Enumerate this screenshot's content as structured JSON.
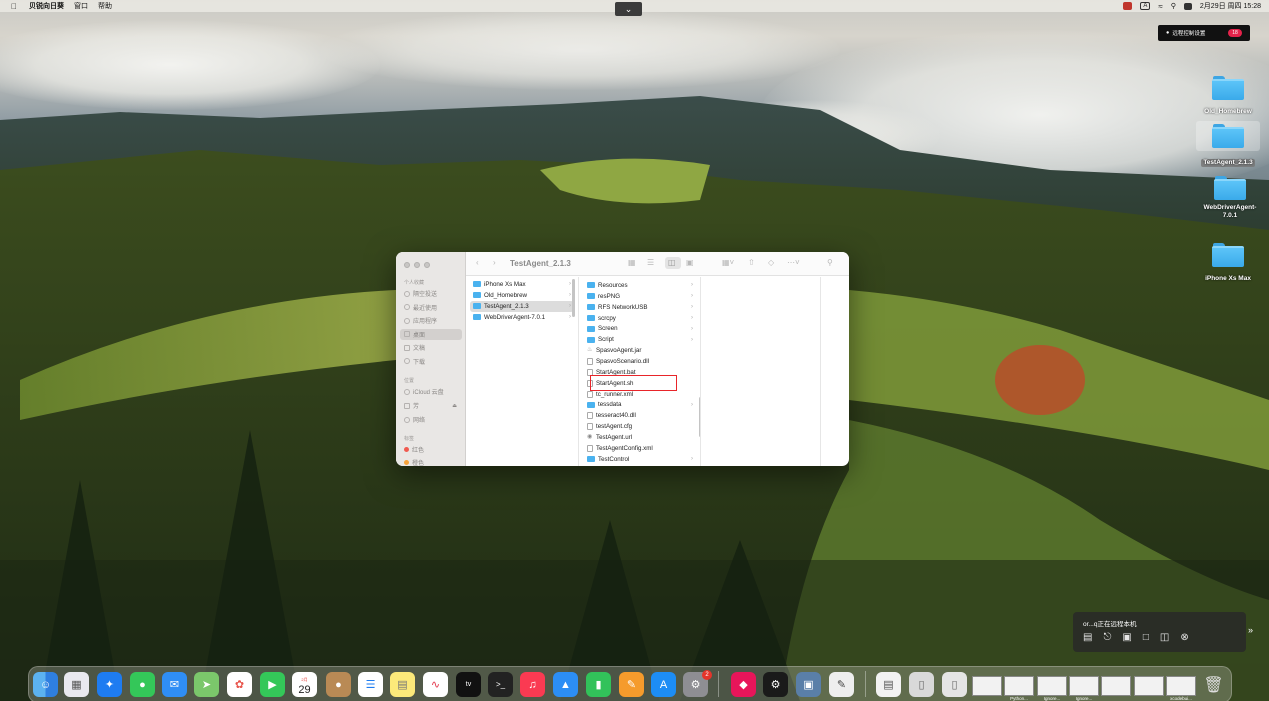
{
  "menubar": {
    "app_name": "贝锐向日葵",
    "items": [
      "窗口",
      "帮助"
    ],
    "status": {
      "input_mode": "A",
      "datetime": "2月29日 周四 15:28"
    }
  },
  "remote_control": {
    "button_label": "远程控制设置",
    "record_badge": "18"
  },
  "desktop_icons": [
    {
      "label": "Old_Homebrew"
    },
    {
      "label": "TestAgent_2.1.3"
    },
    {
      "label": "WebDriverAgent-7.0.1"
    },
    {
      "label": "iPhone Xs Max"
    }
  ],
  "finder": {
    "title": "TestAgent_2.1.3",
    "sidebar": {
      "favorites_heading": "个人收藏",
      "favorites": [
        "隔空投送",
        "最近使用",
        "应用程序",
        "桌面",
        "文稿",
        "下载"
      ],
      "locations_heading": "位置",
      "locations": [
        "iCloud 云盘",
        "芳",
        "网络"
      ],
      "tags_heading": "标签",
      "tags": [
        "红色",
        "橙色"
      ]
    },
    "column1": [
      "iPhone Xs Max",
      "Old_Homebrew",
      "TestAgent_2.1.3",
      "WebDriverAgent-7.0.1"
    ],
    "column2": [
      {
        "name": "Resources",
        "kind": "folder"
      },
      {
        "name": "resPNG",
        "kind": "folder"
      },
      {
        "name": "RFS NetworkUSB",
        "kind": "folder"
      },
      {
        "name": "scrcpy",
        "kind": "folder"
      },
      {
        "name": "Screen",
        "kind": "folder"
      },
      {
        "name": "Script",
        "kind": "folder"
      },
      {
        "name": "SpasvoAgent.jar",
        "kind": "jar"
      },
      {
        "name": "SpasvoScenario.dll",
        "kind": "file"
      },
      {
        "name": "StartAgent.bat",
        "kind": "file"
      },
      {
        "name": "StartAgent.sh",
        "kind": "file"
      },
      {
        "name": "tc_runner.xml",
        "kind": "file"
      },
      {
        "name": "tessdata",
        "kind": "folder"
      },
      {
        "name": "tesseract40.dll",
        "kind": "file"
      },
      {
        "name": "testAgent.cfg",
        "kind": "file"
      },
      {
        "name": "TestAgent.url",
        "kind": "file"
      },
      {
        "name": "TestAgentConfig.xml",
        "kind": "file"
      },
      {
        "name": "TestControl",
        "kind": "folder"
      }
    ],
    "highlighted_item": "StartAgent.sh"
  },
  "remote_panel": {
    "title": "or...q正在远程本机"
  },
  "dock": {
    "calendar_month": "2月",
    "calendar_day": "29",
    "settings_badge": "2",
    "window_thumbs": [
      "Python...",
      "Ignore...",
      "Ignore...",
      "",
      "xcodebui..."
    ]
  },
  "colors": {
    "highlight_border": "#e8252a",
    "folder_blue": "#3aaaea"
  }
}
